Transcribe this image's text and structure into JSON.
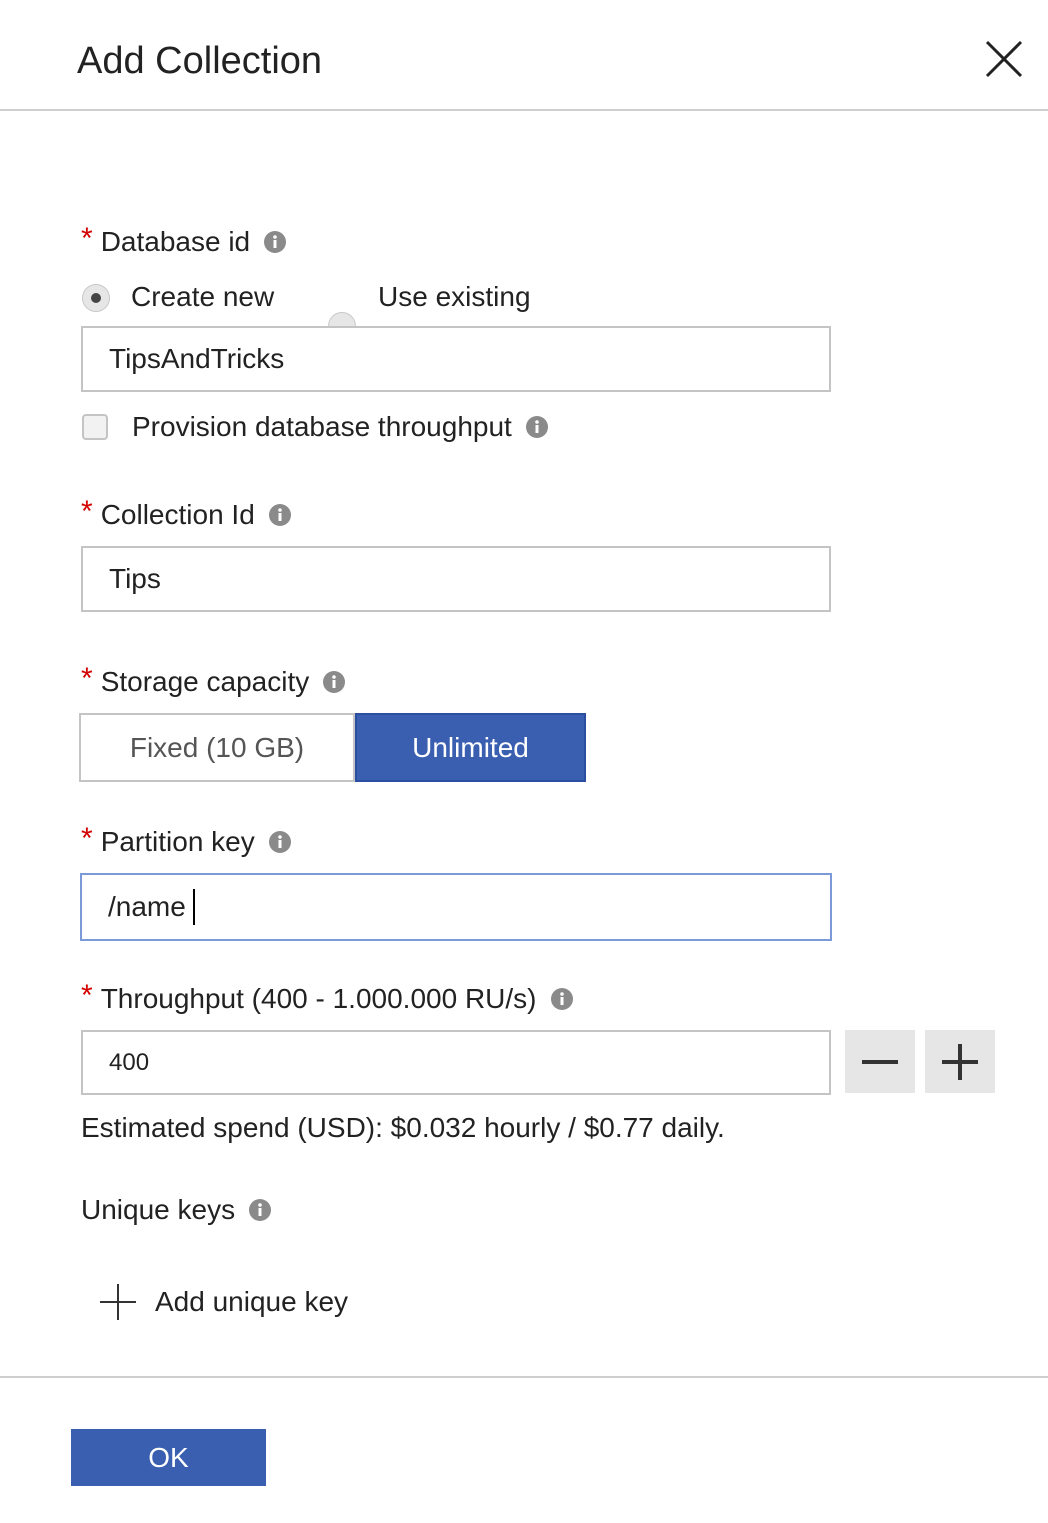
{
  "dialog": {
    "title": "Add Collection",
    "ok_label": "OK"
  },
  "database": {
    "label": "Database id",
    "required_marker": "*",
    "create_new_label": "Create new",
    "use_existing_label": "Use existing",
    "selected_option": "Create new",
    "value": "TipsAndTricks",
    "provision_label": "Provision database throughput",
    "provision_checked": false
  },
  "collection": {
    "label": "Collection Id",
    "required_marker": "*",
    "value": "Tips"
  },
  "storage": {
    "label": "Storage capacity",
    "required_marker": "*",
    "options": [
      "Fixed (10 GB)",
      "Unlimited"
    ],
    "selected": "Unlimited"
  },
  "partition": {
    "label": "Partition key",
    "required_marker": "*",
    "value": "/name"
  },
  "throughput": {
    "label": "Throughput (400 - 1.000.000 RU/s)",
    "required_marker": "*",
    "value": "400",
    "estimate": "Estimated spend (USD): $0.032 hourly / $0.77 daily."
  },
  "unique_keys": {
    "label": "Unique keys",
    "add_label": "Add unique key"
  },
  "colors": {
    "accent": "#3a5fb1",
    "required": "#d40000",
    "focus_border": "#7a9bd8"
  },
  "icons": [
    "close-icon",
    "info-icon",
    "minus-icon",
    "plus-icon"
  ]
}
